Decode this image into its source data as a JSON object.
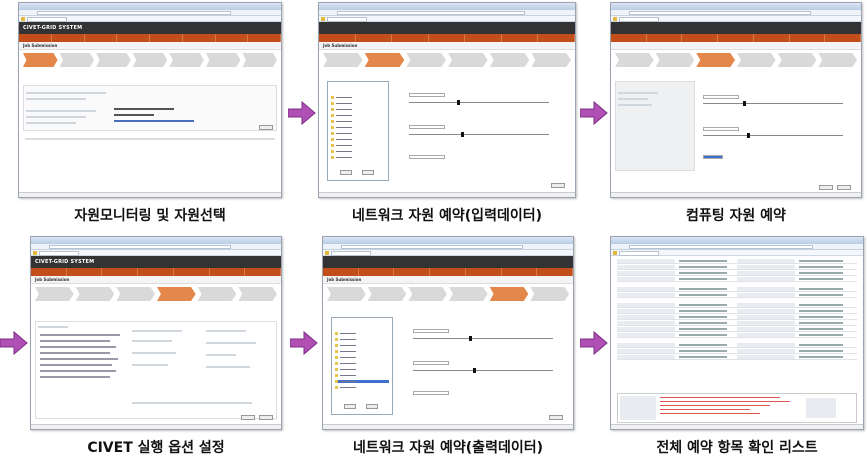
{
  "panels": [
    {
      "caption": "자원모니터링 및 자원선택",
      "app_logo": "CIVET-GRID SYSTEM",
      "section": "Job Submission",
      "button": "다음"
    },
    {
      "caption": "네트워크 자원 예약(입력데이터)",
      "section": "Job Submission",
      "button": "다음"
    },
    {
      "caption": "컴퓨팅 자원 예약",
      "button_prev": "Previous",
      "button_next": "Next"
    },
    {
      "caption": "CIVET 실행 옵션 설정",
      "app_logo": "CIVET-GRID SYSTEM",
      "section": "Job Submission",
      "button_prev": "Previous",
      "button_next": "Next"
    },
    {
      "caption": "네트워크 자원 예약(출력데이터)",
      "section": "Job Submission",
      "button": "다음"
    },
    {
      "caption": "전체 예약 항목 확인 리스트"
    }
  ],
  "colors": {
    "accent": "#c24e1c",
    "active_step": "#e3874a",
    "arrow": "#b04fb4",
    "header": "#333333"
  },
  "icons": {
    "flow_arrow": "arrow-right-icon",
    "folder": "folder-icon"
  }
}
